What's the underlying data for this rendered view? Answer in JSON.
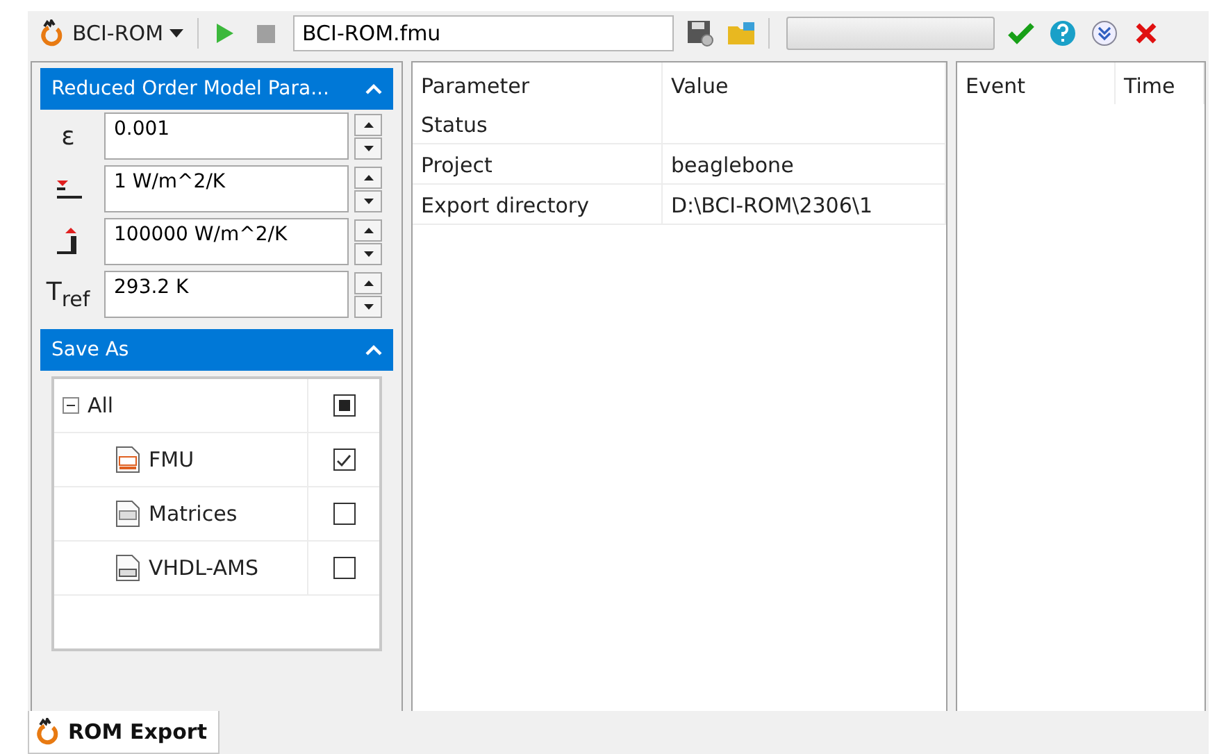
{
  "toolbar": {
    "product": "BCI-ROM",
    "file": "BCI-ROM.fmu",
    "progress": {
      "level": 0
    }
  },
  "rom_panel": {
    "title": "Reduced Order Model Para...",
    "expanded": true,
    "params": [
      {
        "kind": "text",
        "symbol": "ε",
        "value": "0.001"
      },
      {
        "kind": "hmin",
        "value": "1 W/m^2/K"
      },
      {
        "kind": "hmax",
        "value": "100000 W/m^2/K"
      },
      {
        "kind": "text",
        "symbol": "T$_{ref}$",
        "value": "293.2 K"
      }
    ]
  },
  "save_panel": {
    "title": "Save As",
    "expanded": true,
    "tree": [
      {
        "label": "All",
        "expanded": true,
        "checked": false,
        "indeterminate": true,
        "children": [
          {
            "kind": "fmu",
            "label": "FMU",
            "checked": true
          },
          {
            "kind": "matrix",
            "label": "Matrices",
            "checked": false
          },
          {
            "kind": "vhdl",
            "label": "VHDL-AMS",
            "checked": false
          }
        ]
      }
    ]
  },
  "properties": {
    "columns": [
      "Parameter",
      "Value"
    ],
    "rows": [
      {
        "parameter": "Status"
      },
      {
        "parameter": "Project",
        "value": "beaglebone"
      },
      {
        "parameter": "Export directory",
        "value": "D:\\BCI-ROM\\2306\\1"
      }
    ]
  },
  "events": {
    "columns": [
      "Event",
      "Time"
    ]
  },
  "tabs": [
    {
      "label": "ROM Export",
      "selected": true
    }
  ]
}
